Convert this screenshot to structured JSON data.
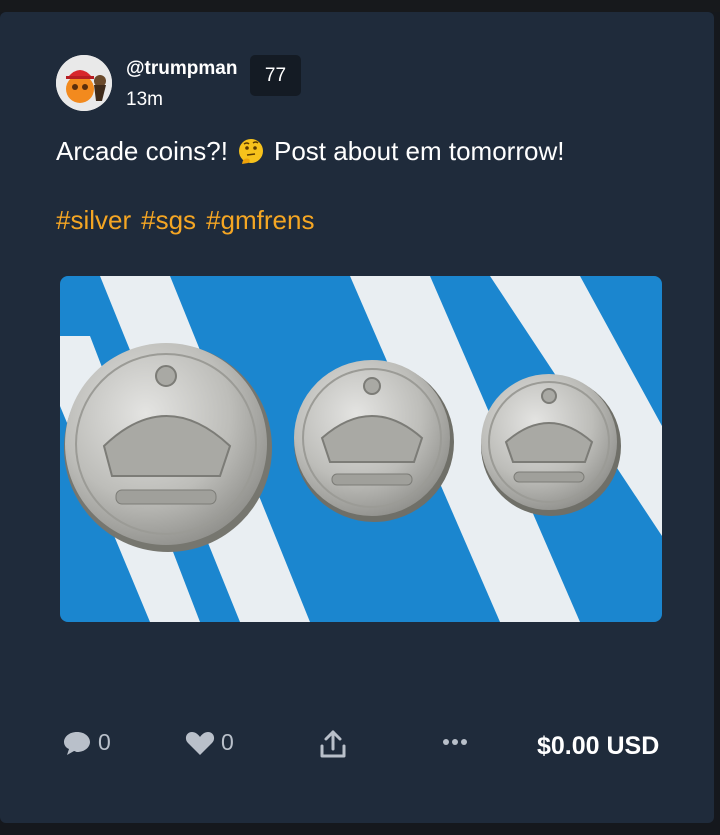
{
  "post": {
    "username": "@trumpman",
    "badge_count": "77",
    "time_ago": "13m",
    "text": "Arcade coins?! 🤔 Post about em tomorrow!",
    "text_before_emoji": "Arcade coins?!",
    "text_after_emoji": "Post about em tomorrow!",
    "emoji": "thinking-face",
    "hashtags": [
      "#silver",
      "#sgs",
      "#gmfrens"
    ],
    "image_description": "three-silver-crown-coins"
  },
  "actions": {
    "comments_count": "0",
    "likes_count": "0",
    "share_icon": "share-icon",
    "more_icon": "more-icon",
    "price": "$0.00 USD"
  },
  "colors": {
    "card_bg": "#1f2b3b",
    "hashtag": "#f5a623",
    "badge_bg": "#141b24",
    "icon": "#b9c0ca"
  }
}
